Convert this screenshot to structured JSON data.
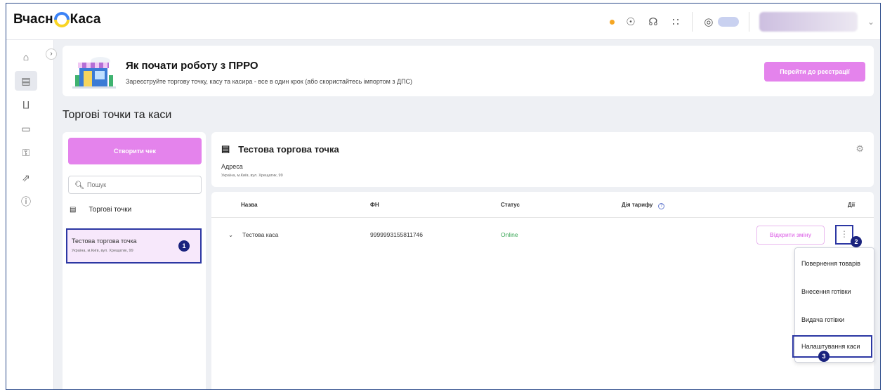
{
  "app": {
    "logo_left": "Вчасн",
    "logo_right": "Каса"
  },
  "banner": {
    "title": "Як почати роботу з ПРРО",
    "subtitle": "Зареєструйте торгову точку, касу та касира - все в один крок (або скористайтесь імпортом з ДПС)",
    "register_button": "Перейти до реєстрації"
  },
  "page": {
    "title": "Торгові точки та каси"
  },
  "left_panel": {
    "create_check_button": "Створити чек",
    "search_placeholder": "Пошук",
    "points_header": "Торгові точки",
    "points": [
      {
        "name": "Тестова торгова точка",
        "address": "Україна, м.Київ, вул. Хрещатик, 99"
      }
    ]
  },
  "store": {
    "title": "Тестова торгова точка",
    "address_label": "Адреса",
    "address": "Україна, м.Київ, вул. Хрещатик, 99"
  },
  "table": {
    "columns": [
      "Назва",
      "ФН",
      "Статус",
      "Дія тарифу",
      "Дії"
    ],
    "rows": [
      {
        "name": "Тестова каса",
        "fn": "9999993155811746",
        "status": "Online",
        "action_button": "Відкрити зміну"
      }
    ]
  },
  "menu": {
    "items": [
      "Повернення товарів",
      "Внесення готівки",
      "Видача готівки",
      "Налаштування каси"
    ]
  },
  "badges": [
    "1",
    "2",
    "3"
  ],
  "colors": {
    "accent_pink": "#e483ec",
    "highlight_blue": "#2c37a3",
    "status_online": "#37a653",
    "badge_navy": "#1a237e"
  }
}
